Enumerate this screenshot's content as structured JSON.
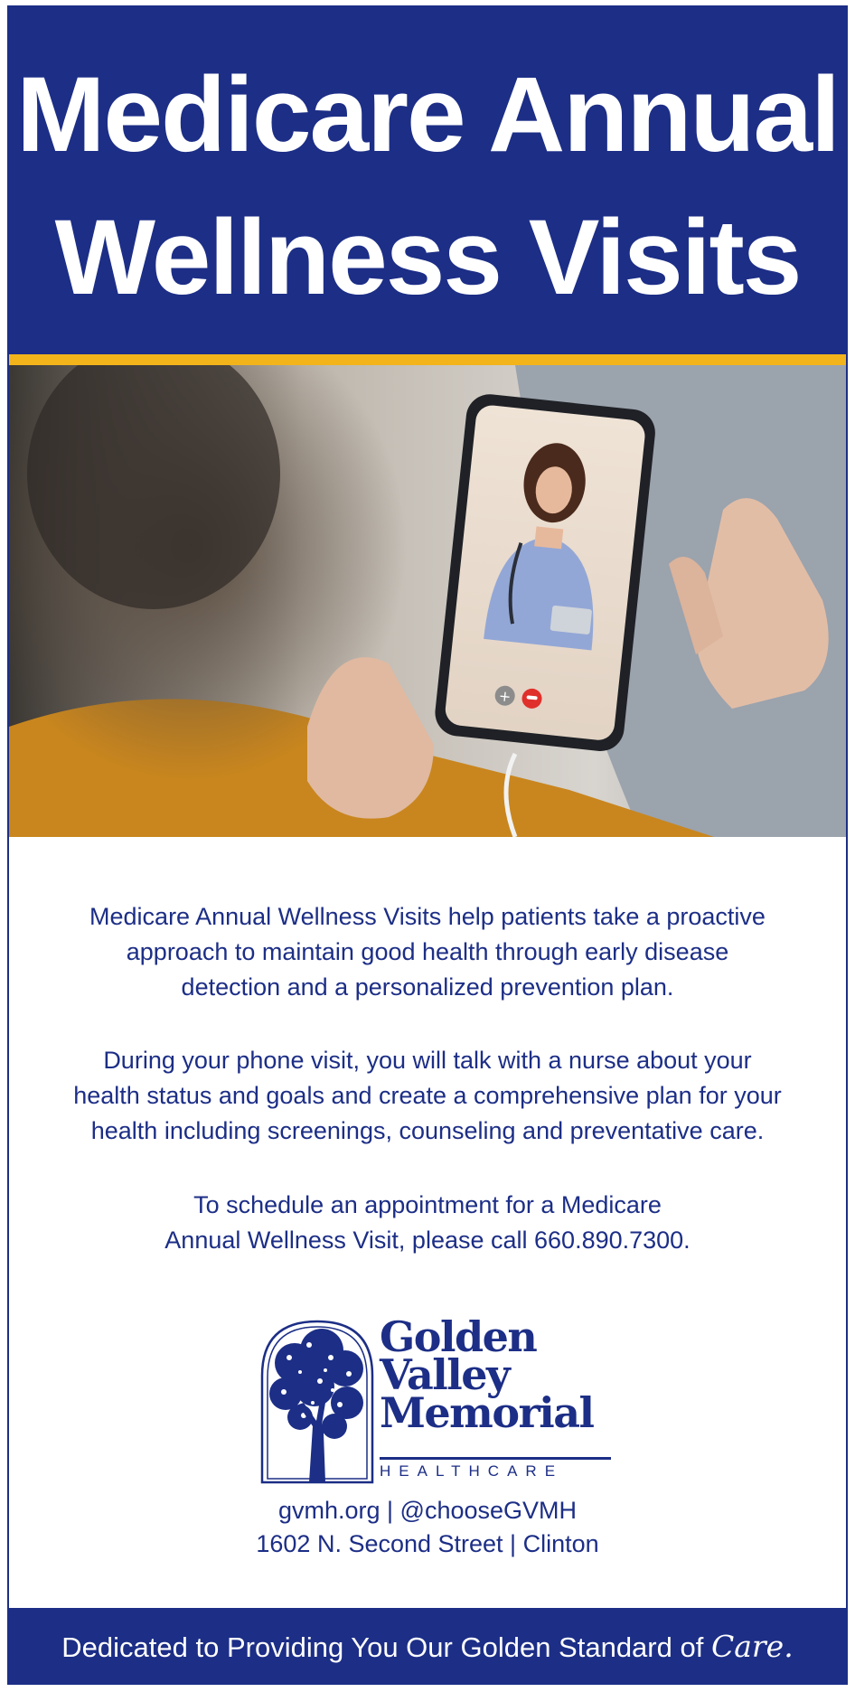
{
  "header": {
    "title_line1": "Medicare Annual",
    "title_line2": "Wellness Visits"
  },
  "colors": {
    "navy": "#1c2e86",
    "gold": "#f3b41b",
    "white": "#ffffff"
  },
  "photo": {
    "icons": [
      "add-call-icon",
      "end-call-icon"
    ]
  },
  "body": {
    "paragraph1_line1": "Medicare Annual Wellness Visits help patients take a proactive",
    "paragraph1_line2": "approach to maintain good health through early disease",
    "paragraph1_line3": "detection and a personalized prevention plan.",
    "paragraph2_line1": "During your phone visit, you will talk with a nurse about your",
    "paragraph2_line2": "health status and goals and create a comprehensive plan for your",
    "paragraph2_line3": "health including screenings, counseling and preventative care.",
    "paragraph3_line1": "To schedule an appointment for a Medicare",
    "paragraph3_line2": "Annual Wellness Visit, please call 660.890.7300."
  },
  "logo": {
    "line1": "Golden",
    "line2": "Valley",
    "line3": "Memorial",
    "line4": "HEALTHCARE"
  },
  "contact": {
    "line1": "gvmh.org | @chooseGVMH",
    "line2": "1602 N. Second Street | Clinton"
  },
  "footer": {
    "tagline": "Dedicated to Providing You Our Golden Standard of",
    "tagline_script": "Care."
  }
}
